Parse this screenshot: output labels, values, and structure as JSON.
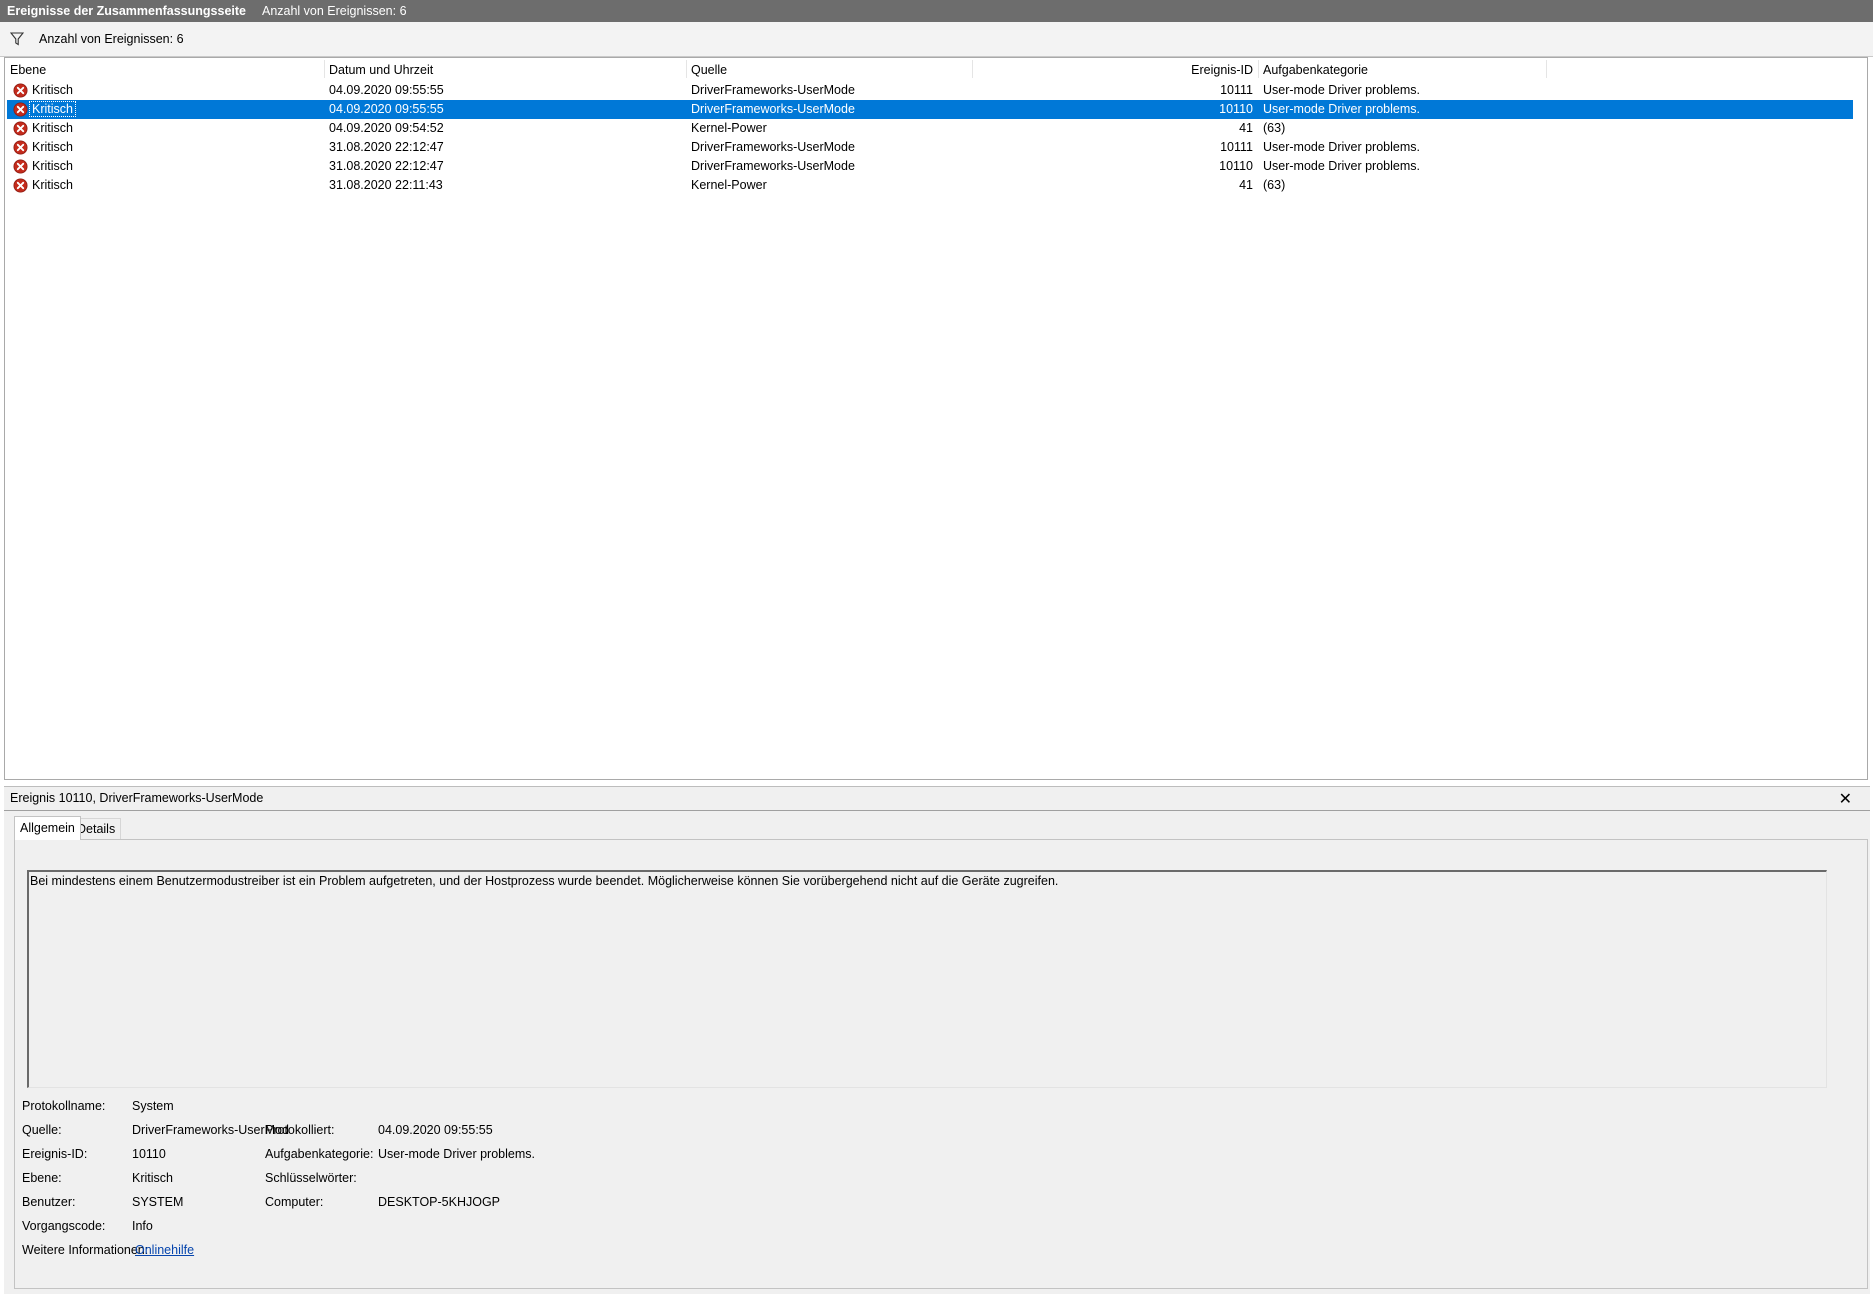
{
  "titlebar": {
    "title": "Ereignisse der Zusammenfassungsseite",
    "count_text": "Anzahl von Ereignissen: 6"
  },
  "summary": {
    "filter_icon": "filter-icon",
    "text": "Anzahl von Ereignissen: 6"
  },
  "columns": {
    "ebene": "Ebene",
    "datum": "Datum und Uhrzeit",
    "quelle": "Quelle",
    "id": "Ereignis-ID",
    "kategorie": "Aufgabenkategorie"
  },
  "events": [
    {
      "level": "Kritisch",
      "datetime": "04.09.2020 09:55:55",
      "source": "DriverFrameworks-UserMode",
      "id": "10111",
      "category": "User-mode Driver problems.",
      "selected": false
    },
    {
      "level": "Kritisch",
      "datetime": "04.09.2020 09:55:55",
      "source": "DriverFrameworks-UserMode",
      "id": "10110",
      "category": "User-mode Driver problems.",
      "selected": true
    },
    {
      "level": "Kritisch",
      "datetime": "04.09.2020 09:54:52",
      "source": "Kernel-Power",
      "id": "41",
      "category": "(63)",
      "selected": false
    },
    {
      "level": "Kritisch",
      "datetime": "31.08.2020 22:12:47",
      "source": "DriverFrameworks-UserMode",
      "id": "10111",
      "category": "User-mode Driver problems.",
      "selected": false
    },
    {
      "level": "Kritisch",
      "datetime": "31.08.2020 22:12:47",
      "source": "DriverFrameworks-UserMode",
      "id": "10110",
      "category": "User-mode Driver problems.",
      "selected": false
    },
    {
      "level": "Kritisch",
      "datetime": "31.08.2020 22:11:43",
      "source": "Kernel-Power",
      "id": "41",
      "category": "(63)",
      "selected": false
    }
  ],
  "detail": {
    "title": "Ereignis 10110, DriverFrameworks-UserMode",
    "close_glyph": "✕",
    "tabs": [
      "Allgemein",
      "Details"
    ],
    "description": "Bei mindestens einem Benutzermodustreiber ist ein Problem aufgetreten, und der Hostprozess wurde beendet. Möglicherweise können Sie vorübergehend nicht auf die Geräte zugreifen.",
    "labels": {
      "protokollname": "Protokollname:",
      "quelle": "Quelle:",
      "ereignis_id": "Ereignis-ID:",
      "ebene": "Ebene:",
      "benutzer": "Benutzer:",
      "vorgangscode": "Vorgangscode:",
      "weitere": "Weitere Informationen:",
      "protokolliert": "Protokolliert:",
      "aufgabenkategorie": "Aufgabenkategorie:",
      "schluesselwoerter": "Schlüsselwörter:",
      "computer": "Computer:"
    },
    "values": {
      "protokollname": "System",
      "quelle": "DriverFrameworks-UserMod",
      "ereignis_id": "10110",
      "ebene": "Kritisch",
      "benutzer": "SYSTEM",
      "vorgangscode": "Info",
      "weitere": "Onlinehilfe",
      "protokolliert": "04.09.2020 09:55:55",
      "aufgabenkategorie": "User-mode Driver problems.",
      "schluesselwoerter": "",
      "computer": "DESKTOP-5KHJOGP"
    }
  },
  "colors": {
    "titlebar_bg": "#6d6d6d",
    "selection": "#0078d7",
    "critical_icon": "#c42b1c"
  }
}
